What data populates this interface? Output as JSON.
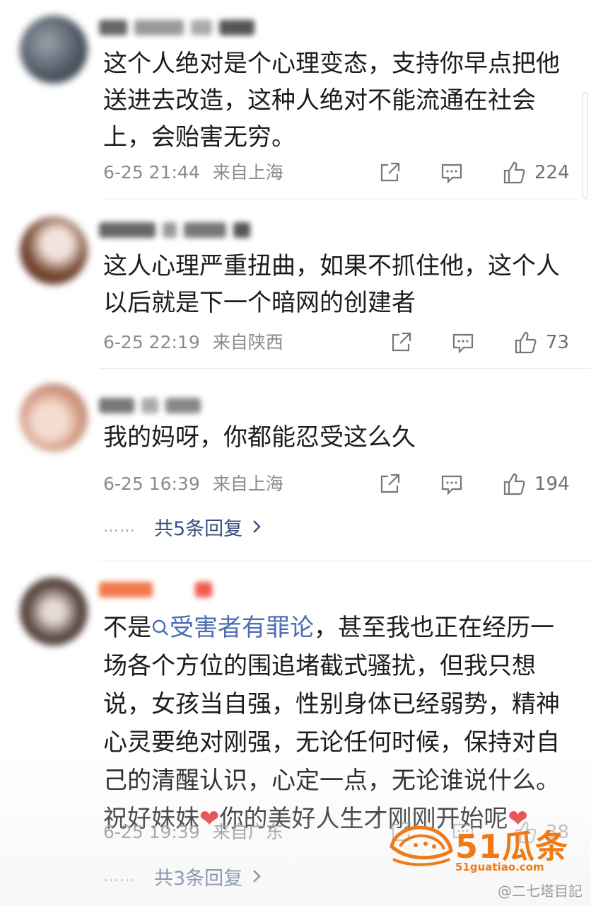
{
  "comments": [
    {
      "text": "这个人绝对是个心理变态，支持你早点把他送进去改造，这种人绝对不能流通在社会上，会贻害无穷。",
      "time": "6-25 21:44",
      "location": "来自上海",
      "likes": "224"
    },
    {
      "text": "这人心理严重扭曲，如果不抓住他，这个人以后就是下一个暗网的创建者",
      "time": "6-25 22:19",
      "location": "来自陕西",
      "likes": "73"
    },
    {
      "text": "我的妈呀，你都能忍受这么久",
      "time": "6-25 16:39",
      "location": "来自上海",
      "likes": "194",
      "replies": "共5条回复",
      "replies_dots": "……"
    },
    {
      "text_prefix": "不是",
      "topic": "受害者有罪论",
      "text_middle": "，甚至我也正在经历一场各个方位的围追堵截式骚扰，但我只想说，女孩当自强，性别身体已经弱势，精神心灵要绝对刚强，无论任何时候，保持对自己的清醒认识，心定一点，无论谁说什么。祝好妹妹",
      "text_middle2": "你的美好人生才刚刚开始呢",
      "heart": "❤",
      "time": "6-25 19:39",
      "location": "来自广东",
      "likes": "38",
      "replies": "共3条回复",
      "replies_dots": "……"
    }
  ],
  "icons": {
    "share": "share-icon",
    "comment": "comment-icon",
    "like": "thumbs-up-icon",
    "search_topic": "search-icon",
    "chevron": "chevron-right-icon"
  },
  "branding": {
    "logo_text": "51瓜条",
    "logo_url_text": "51guatiao.com",
    "watermark": "@二七塔目記"
  },
  "colors": {
    "topic": "#4a6db4",
    "reply_link": "#3a4f7e",
    "meta": "#8b8b8b",
    "heart": "#e02b2b",
    "logo": "#f07a16"
  }
}
